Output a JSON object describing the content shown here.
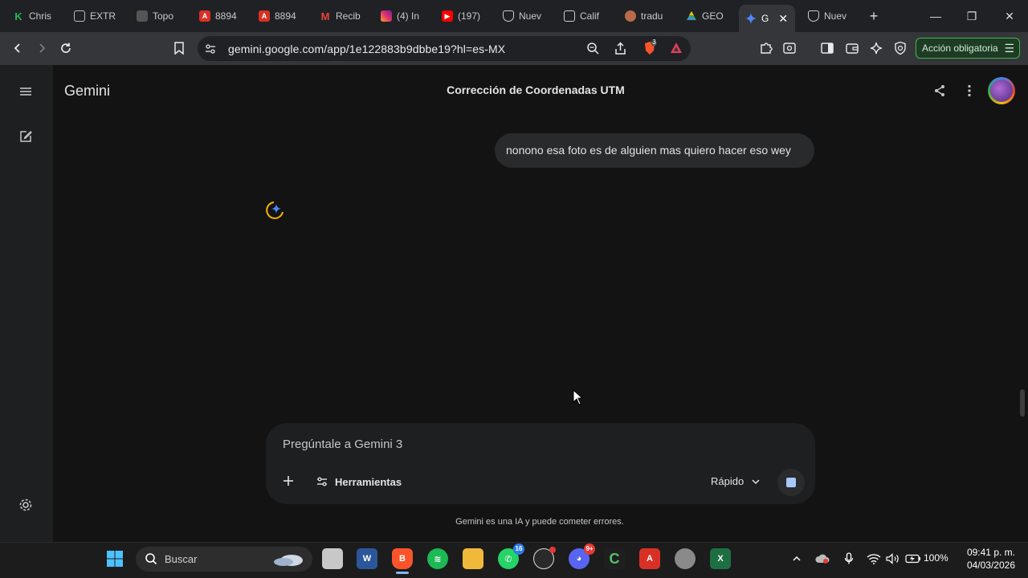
{
  "browser": {
    "tabs": [
      {
        "label": "Chris",
        "icon": "k-icon",
        "color": "#1db954"
      },
      {
        "label": "EXTR",
        "icon": "image-icon",
        "color": "#888888"
      },
      {
        "label": "Topo",
        "icon": "topo-icon",
        "color": "#777777"
      },
      {
        "label": "8894",
        "icon": "pdf-icon",
        "color": "#d93025"
      },
      {
        "label": "8894",
        "icon": "pdf-icon",
        "color": "#d93025"
      },
      {
        "label": "Recib",
        "icon": "gmail-icon",
        "color": "#ea4335"
      },
      {
        "label": "(4) In",
        "icon": "instagram-icon",
        "color": "#e1306c"
      },
      {
        "label": "(197)",
        "icon": "youtube-icon",
        "color": "#ff0000"
      },
      {
        "label": "Nuev",
        "icon": "shield-icon",
        "color": "#cccccc"
      },
      {
        "label": "Calif",
        "icon": "document-icon",
        "color": "#cccccc"
      },
      {
        "label": "tradu",
        "icon": "translate-icon",
        "color": "#b86b4b"
      },
      {
        "label": "GEO",
        "icon": "drive-icon",
        "color": "#34a853"
      },
      {
        "label": "G",
        "icon": "gemini-icon",
        "color": "#4e86f6"
      },
      {
        "label": "Nuev",
        "icon": "shield-icon",
        "color": "#cccccc"
      }
    ],
    "url": "gemini.google.com/app/1e122883b9dbbe19?hl=es-MX",
    "shield_count": "3",
    "action_button": "Acción obligatoria"
  },
  "app": {
    "brand": "Gemini",
    "conversation_title": "Corrección de Coordenadas UTM",
    "user_message": "nonono esa foto es de alguien mas quiero hacer eso wey",
    "composer": {
      "placeholder": "Pregúntale a Gemini 3",
      "tools_label": "Herramientas",
      "mode_label": "Rápido"
    },
    "disclaimer": "Gemini es una IA y puede cometer errores."
  },
  "taskbar": {
    "search_label": "Buscar",
    "whatsapp_badge": "16",
    "discord_badge": "9+",
    "battery": "100%",
    "time": "09:41 p. m.",
    "date": "04/03/2026"
  },
  "colors": {
    "accent": "#a8c7fa",
    "background": "#131314",
    "action_green": "#3fb950"
  }
}
